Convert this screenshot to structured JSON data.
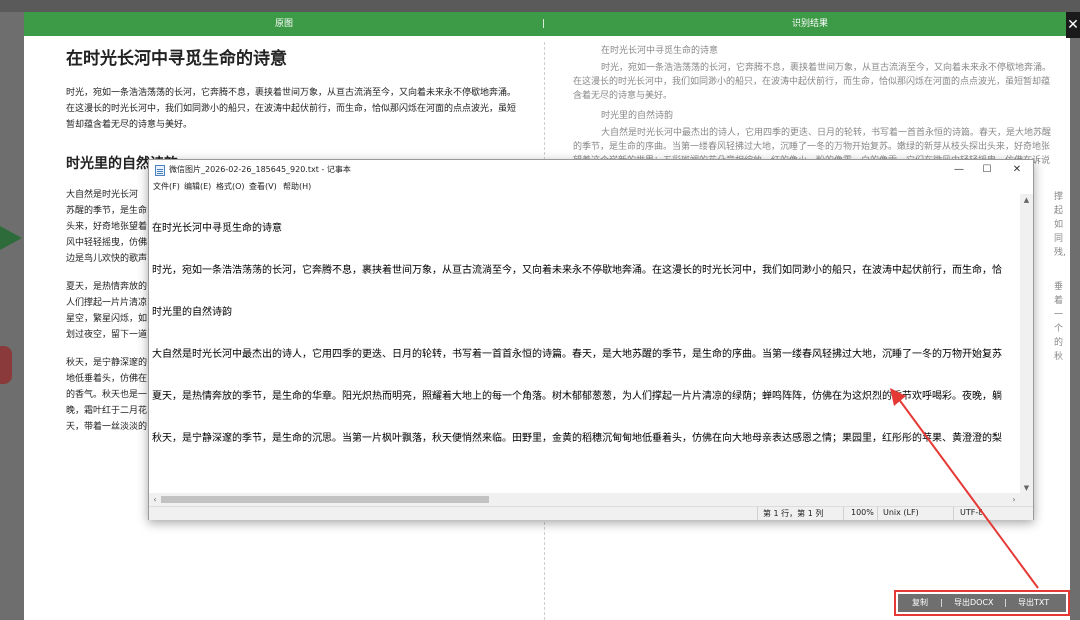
{
  "modal": {
    "header_left": "原图",
    "header_sep": "|",
    "header_right": "识别结果",
    "close": "✕"
  },
  "original": {
    "title1": "在时光长河中寻觅生命的诗意",
    "para1": "时光，宛如一条浩浩荡荡的长河，它奔腾不息，裹挟着世间万象，从亘古流淌至今，又向着未来永不停歇地奔涌。在这漫长的时光长河中，我们如同渺小的船只，在波涛中起伏前行，而生命，恰似那闪烁在河面的点点波光，虽短暂却蕴含着无尽的诗意与美好。",
    "title2": "时光里的自然诗韵",
    "lines": [
      "大自然是时光长河",
      "苏醒的季节，是生命",
      "头来，好奇地张望着",
      "风中轻轻摇曳，仿佛",
      "边是鸟儿欢快的歌声",
      "",
      "夏天，是热情奔放的",
      "人们撑起一片片清凉",
      "星空，繁星闪烁，如",
      "划过夜空，留下一道",
      "",
      "秋天，是宁静深邃的",
      "地低垂着头，仿佛在",
      "的香气。秋天也是一",
      "晚，霜叶红于二月花",
      "天，带着一丝淡淡的"
    ]
  },
  "result": {
    "title1": "在时光长河中寻觅生命的诗意",
    "para1": "时光，宛如一条浩浩荡荡的长河，它奔腾不息，裹挟着世间万象，从亘古流淌至今，又向着未来永不停歇地奔涌。在这漫长的时光长河中，我们如同渺小的船只，在波涛中起伏前行，而生命，恰似那闪烁在河面的点点波光，虽短暂却蕴含着无尽的诗意与美好。",
    "title2": "时光里的自然诗韵",
    "para2": "大自然是时光长河中最杰出的诗人，它用四季的更迭、日月的轮转，书写着一首首永恒的诗篇。春天，是大地苏醒的季节，是生命的序曲。当第一缕春风轻拂过大地，沉睡了一冬的万物开始复苏。嫩绿的新芽从枝头探出头来，好奇地张望着这个崭新的世界；五彩斑斓的花朵竞相绽放，红的像火，粉的像霞，白的像雪，它们在微风中轻轻摇曳，仿佛在诉说着生命的",
    "right_frag": [
      "撑起",
      "如同",
      "残,",
      "垂着",
      "一个",
      "的秋"
    ]
  },
  "actions": {
    "copy": "复制",
    "export_docx": "导出DOCX",
    "export_txt": "导出TXT",
    "sep": "|"
  },
  "notepad": {
    "title": "微信图片_2026-02-26_185645_920.txt - 记事本",
    "minimize": "—",
    "maximize": "☐",
    "close": "✕",
    "menu": [
      "文件(F)",
      "编辑(E)",
      "格式(O)",
      "查看(V)",
      "帮助(H)"
    ],
    "lines": [
      "在时光长河中寻觅生命的诗意",
      "时光，宛如一条浩浩荡荡的长河，它奔腾不息，裹挟着世间万象，从亘古流淌至今，又向着未来永不停歇地奔涌。在这漫长的时光长河中，我们如同渺小的船只，在波涛中起伏前行，而生命，恰",
      "时光里的自然诗韵",
      "大自然是时光长河中最杰出的诗人，它用四季的更迭、日月的轮转，书写着一首首永恒的诗篇。春天，是大地苏醒的季节，是生命的序曲。当第一缕春风轻拂过大地，沉睡了一冬的万物开始复苏",
      "夏天，是热情奔放的季节，是生命的华章。阳光炽热而明亮，照耀着大地上的每一个角落。树木郁郁葱葱，为人们撑起一片片清凉的绿荫；蝉鸣阵阵，仿佛在为这炽烈的季节欢呼喝彩。夜晚，躺",
      "秋天，是宁静深邃的季节，是生命的沉思。当第一片枫叶飘落，秋天便悄然来临。田野里，金黄的稻穗沉甸甸地低垂着头，仿佛在向大地母亲表达感恩之情；果园里，红彤彤的苹果、黄澄澄的梨"
    ],
    "status": {
      "position": "第 1 行，第 1 列",
      "zoom": "100%",
      "eol": "Unix (LF)",
      "encoding": "UTF-8"
    }
  }
}
